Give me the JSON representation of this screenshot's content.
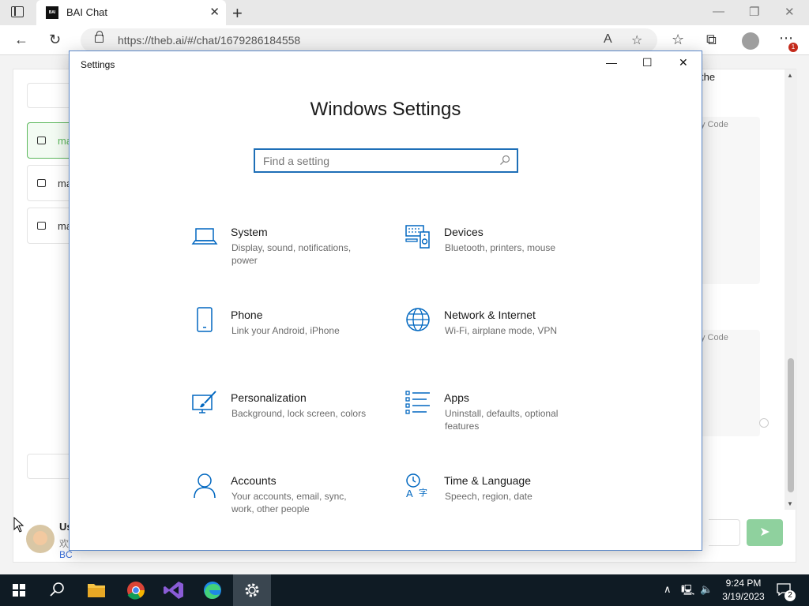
{
  "browser": {
    "tab_title": "BAI Chat",
    "tab_favicon_text": "BAI",
    "url": "https://theb.ai/#/chat/1679286184558",
    "notification_count": "1"
  },
  "page": {
    "chat_items": [
      {
        "label": "ma"
      },
      {
        "label": "ma"
      },
      {
        "label": "ma"
      }
    ],
    "user_name": "Us",
    "user_sub1": "欢",
    "user_sub2": "BC",
    "right_text": "the",
    "copy_code_1": "y  Code",
    "copy_code_2": "y  Code"
  },
  "settings": {
    "window_title": "Settings",
    "heading": "Windows Settings",
    "search_placeholder": "Find a setting",
    "tiles": [
      {
        "title": "System",
        "desc": "Display, sound, notifications, power",
        "icon": "laptop-icon"
      },
      {
        "title": "Devices",
        "desc": "Bluetooth, printers, mouse",
        "icon": "devices-icon"
      },
      {
        "title": "Phone",
        "desc": "Link your Android, iPhone",
        "icon": "phone-icon"
      },
      {
        "title": "Network & Internet",
        "desc": "Wi-Fi, airplane mode, VPN",
        "icon": "globe-icon"
      },
      {
        "title": "Personalization",
        "desc": "Background, lock screen, colors",
        "icon": "brush-icon"
      },
      {
        "title": "Apps",
        "desc": "Uninstall, defaults, optional features",
        "icon": "apps-list-icon"
      },
      {
        "title": "Accounts",
        "desc": "Your accounts, email, sync, work, other people",
        "icon": "person-icon"
      },
      {
        "title": "Time & Language",
        "desc": "Speech, region, date",
        "icon": "time-language-icon"
      }
    ]
  },
  "taskbar": {
    "time": "9:24 PM",
    "date": "3/19/2023",
    "notification_count": "2"
  },
  "colors": {
    "accent": "#0067c0",
    "window_border": "#5b87c7",
    "taskbar": "#0f1b24",
    "active_chat": "#5cb85c"
  }
}
